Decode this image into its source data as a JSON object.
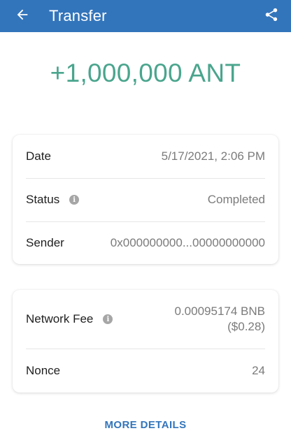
{
  "header": {
    "title": "Transfer",
    "back_icon": "arrow-left-icon",
    "share_icon": "share-icon",
    "color": "#3375bb"
  },
  "amount": {
    "text": "+1,000,000 ANT",
    "color": "#4aa58d"
  },
  "details": {
    "date_label": "Date",
    "date_value": "5/17/2021, 2:06 PM",
    "status_label": "Status",
    "status_value": "Completed",
    "sender_label": "Sender",
    "sender_value": "0x000000000...00000000000"
  },
  "fees": {
    "network_fee_label": "Network Fee",
    "network_fee_value": "0.00095174 BNB",
    "network_fee_fiat": "($0.28)",
    "nonce_label": "Nonce",
    "nonce_value": "24"
  },
  "more_details_label": "MORE DETAILS"
}
